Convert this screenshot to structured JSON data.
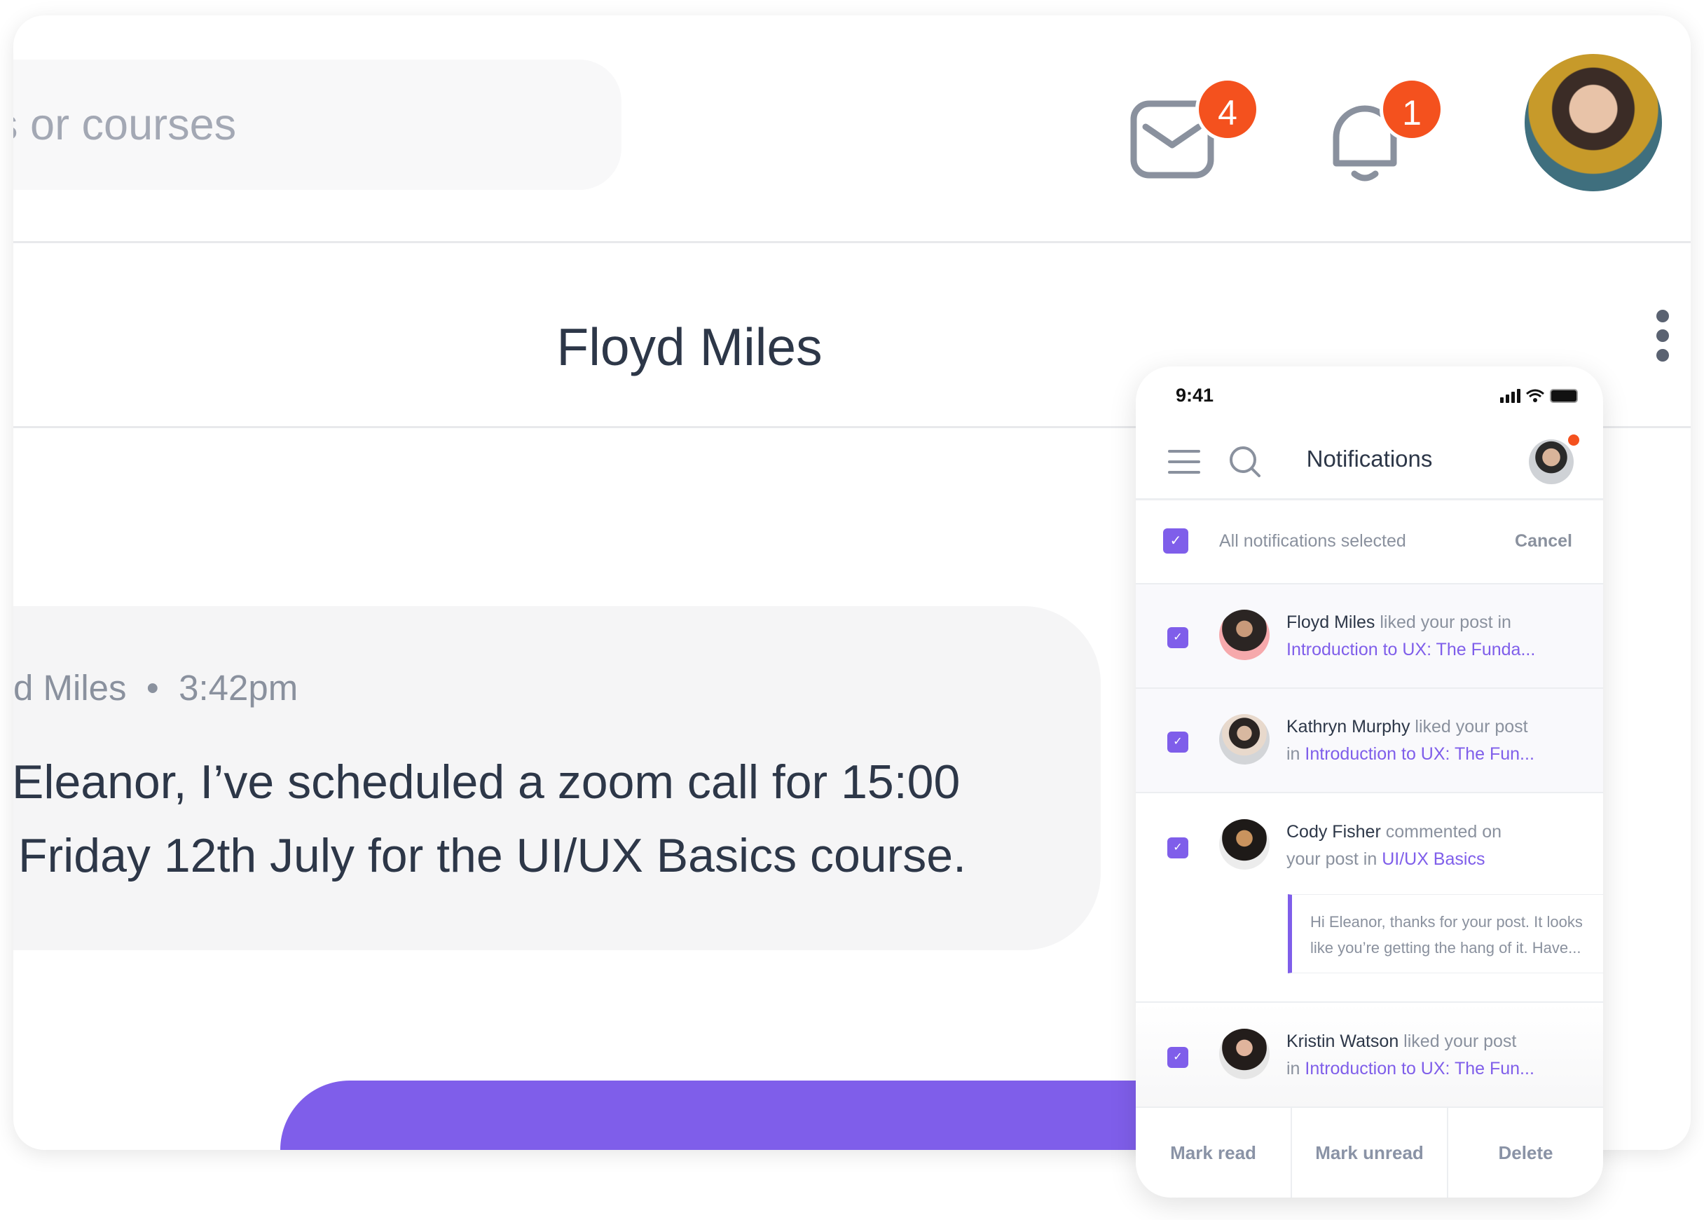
{
  "header": {
    "search_placeholder": "es or courses",
    "mail_badge": "4",
    "bell_badge": "1"
  },
  "conversation": {
    "title": "Floyd Miles",
    "sender": "d Miles",
    "separator": "•",
    "time": "3:42pm",
    "message_lines": [
      "Eleanor, I’ve scheduled a zoom call for 15:00",
      "Friday 12th July for the UI/UX Basics course."
    ]
  },
  "colors": {
    "accent": "#7f5eea",
    "badge": "#f4511e",
    "text": "#2d3748",
    "muted": "#8a919e"
  },
  "phone": {
    "status_time": "9:41",
    "title": "Notifications",
    "select_all_label": "All notifications selected",
    "cancel_label": "Cancel",
    "items": [
      {
        "name": "Floyd Miles",
        "action": " liked your post in",
        "prefix": "",
        "link": "Introduction to UX: The Funda..."
      },
      {
        "name": "Kathryn Murphy",
        "action": " liked your post",
        "prefix": "in ",
        "link": "Introduction to UX: The Fun..."
      },
      {
        "name": "Cody Fisher",
        "action": " commented on",
        "prefix": "your post in ",
        "link": "UI/UX Basics",
        "quote": [
          "Hi Eleanor, thanks for your post. It looks",
          "like you’re getting the hang of it. Have..."
        ]
      },
      {
        "name": "Kristin Watson",
        "action": " liked your post",
        "prefix": "in ",
        "link": "Introduction to UX: The Fun..."
      }
    ],
    "footer": [
      "Mark read",
      "Mark unread",
      "Delete"
    ]
  }
}
